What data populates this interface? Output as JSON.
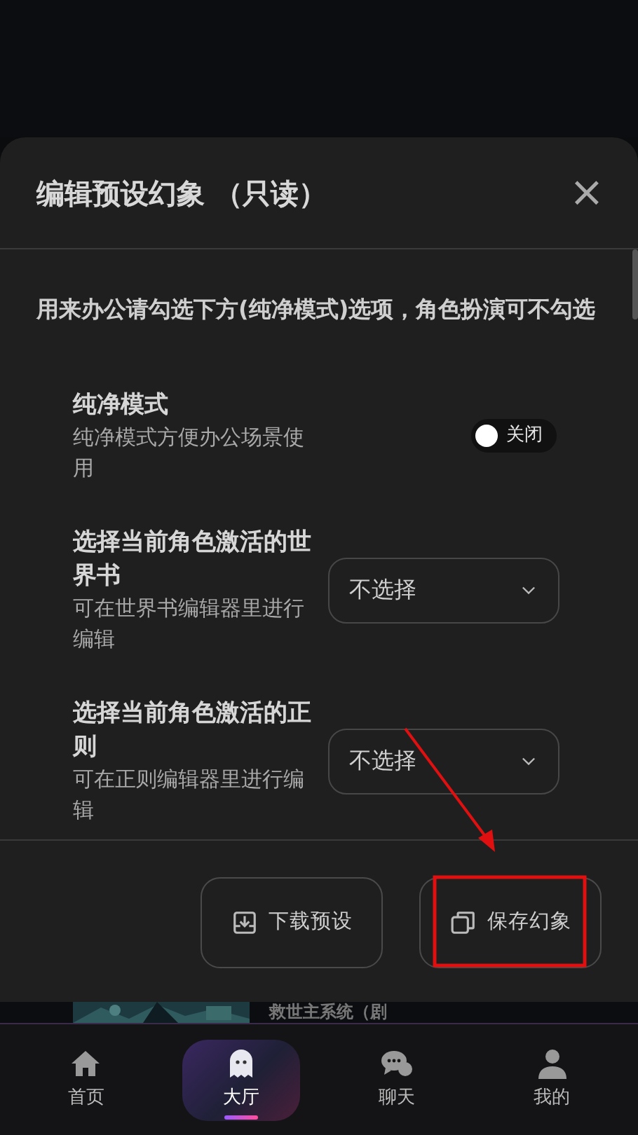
{
  "background": {
    "card_title": "救世主系统（剧"
  },
  "dialog": {
    "title": "编辑预设幻象 （只读）",
    "close": "×",
    "hint": "用来办公请勾选下方(纯净模式)选项，角色扮演可不勾选",
    "settings": [
      {
        "kind": "toggle",
        "label": "纯净模式",
        "description": "纯净模式方便办公场景使用",
        "on": false,
        "state_text": "关闭"
      },
      {
        "kind": "select",
        "label": "选择当前角色激活的世界书",
        "description": "可在世界书编辑器里进行编辑",
        "value": "不选择"
      },
      {
        "kind": "select",
        "label": "选择当前角色激活的正则",
        "description": "可在正则编辑器里进行编辑",
        "value": "不选择"
      }
    ],
    "buttons": [
      {
        "kind": "download",
        "label": "下载预设"
      },
      {
        "kind": "copy",
        "label": "保存幻象"
      }
    ]
  },
  "annotations": [
    {
      "kind": "arrow"
    },
    {
      "kind": "frame"
    }
  ],
  "nav": [
    {
      "kind": "home",
      "label": "首页",
      "selected": false
    },
    {
      "kind": "ghost",
      "label": "大厅",
      "selected": true
    },
    {
      "kind": "chat",
      "label": "聊天",
      "selected": false
    },
    {
      "kind": "user",
      "label": "我的",
      "selected": false
    }
  ]
}
